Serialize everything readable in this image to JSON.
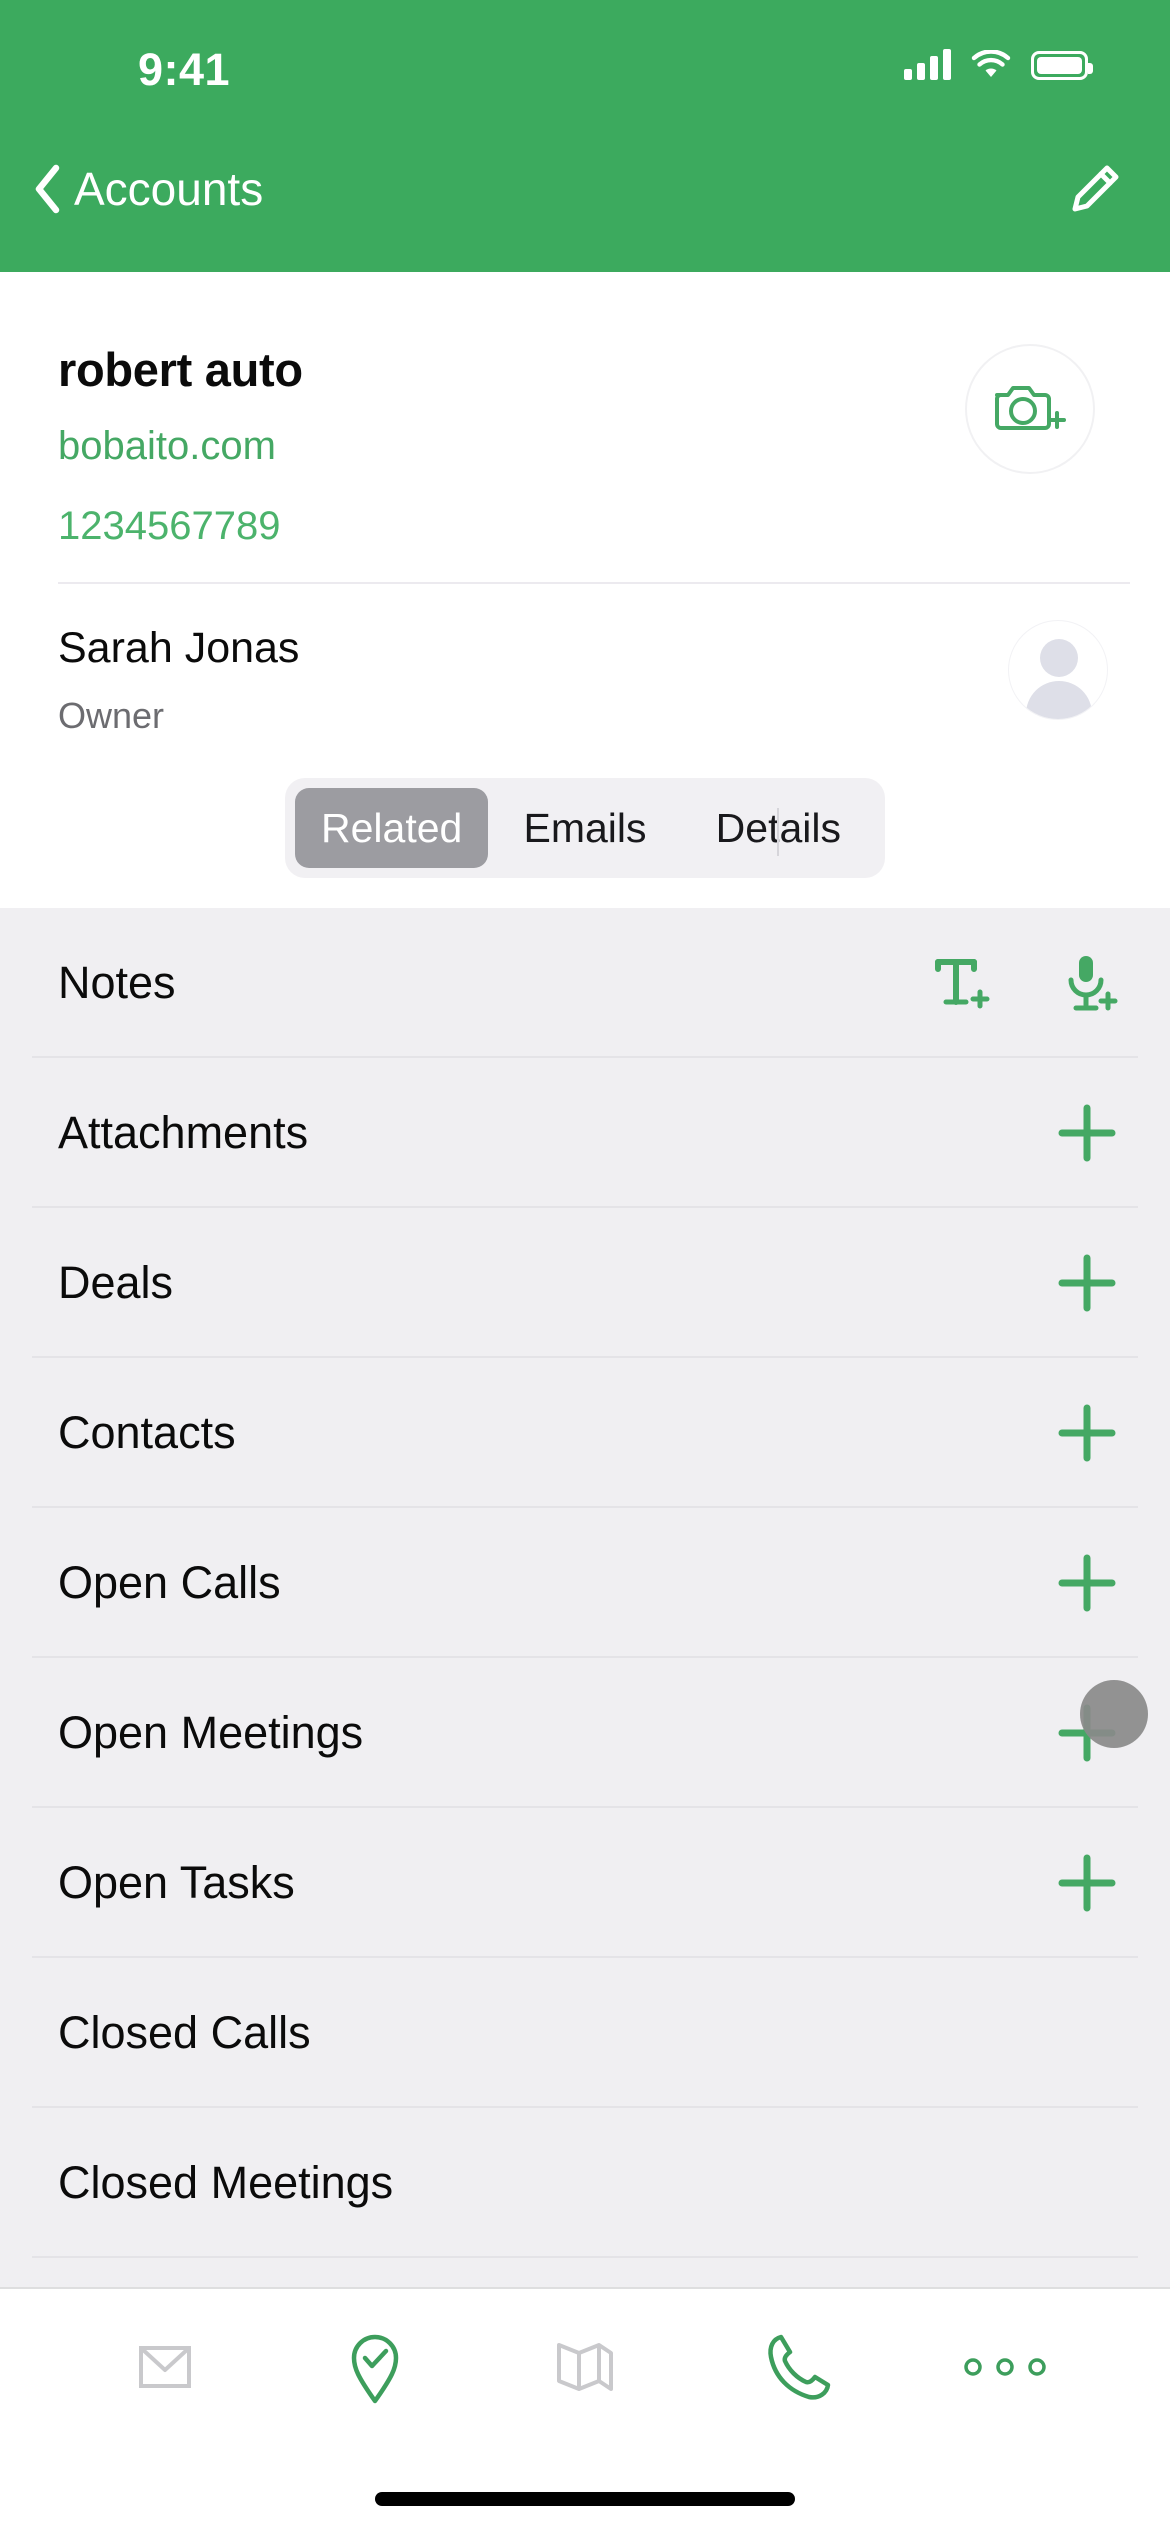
{
  "status_bar": {
    "time": "9:41",
    "icons": [
      "cellular-signal-icon",
      "wifi-icon",
      "battery-icon"
    ]
  },
  "nav": {
    "back_label": "Accounts",
    "back_icon": "chevron-left-icon",
    "edit_icon": "pencil-icon"
  },
  "account": {
    "name": "robert auto",
    "website": "bobaito.com",
    "phone": "1234567789",
    "photo_action_icon": "camera-plus-icon"
  },
  "owner": {
    "name": "Sarah Jonas",
    "role": "Owner",
    "avatar_icon": "person-avatar-icon"
  },
  "tabs": {
    "items": [
      {
        "label": "Related",
        "active": true
      },
      {
        "label": "Emails",
        "active": false
      },
      {
        "label": "Details",
        "active": false
      }
    ]
  },
  "related_list": {
    "rows": [
      {
        "label": "Notes",
        "actions": [
          "text-note-add-icon",
          "voice-note-add-icon"
        ]
      },
      {
        "label": "Attachments",
        "actions": [
          "plus-icon"
        ]
      },
      {
        "label": "Deals",
        "actions": [
          "plus-icon"
        ]
      },
      {
        "label": "Contacts",
        "actions": [
          "plus-icon"
        ]
      },
      {
        "label": "Open Calls",
        "actions": [
          "plus-icon"
        ]
      },
      {
        "label": "Open Meetings",
        "actions": [
          "plus-icon"
        ],
        "cursor": true
      },
      {
        "label": "Open Tasks",
        "actions": [
          "plus-icon"
        ]
      },
      {
        "label": "Closed Calls",
        "actions": []
      },
      {
        "label": "Closed Meetings",
        "actions": []
      }
    ]
  },
  "bottom_bar": {
    "items": [
      {
        "icon": "email-icon",
        "enabled": false
      },
      {
        "icon": "check-in-pin-icon",
        "enabled": true
      },
      {
        "icon": "map-icon",
        "enabled": false
      },
      {
        "icon": "phone-icon",
        "enabled": true
      },
      {
        "icon": "more-options-icon",
        "enabled": true
      }
    ]
  },
  "colors": {
    "header_green": "#3caa5e",
    "accent_green": "#45a864",
    "list_background": "#f0eff2",
    "card_background": "#ffffff",
    "segment_active": "#9c9ca1"
  }
}
